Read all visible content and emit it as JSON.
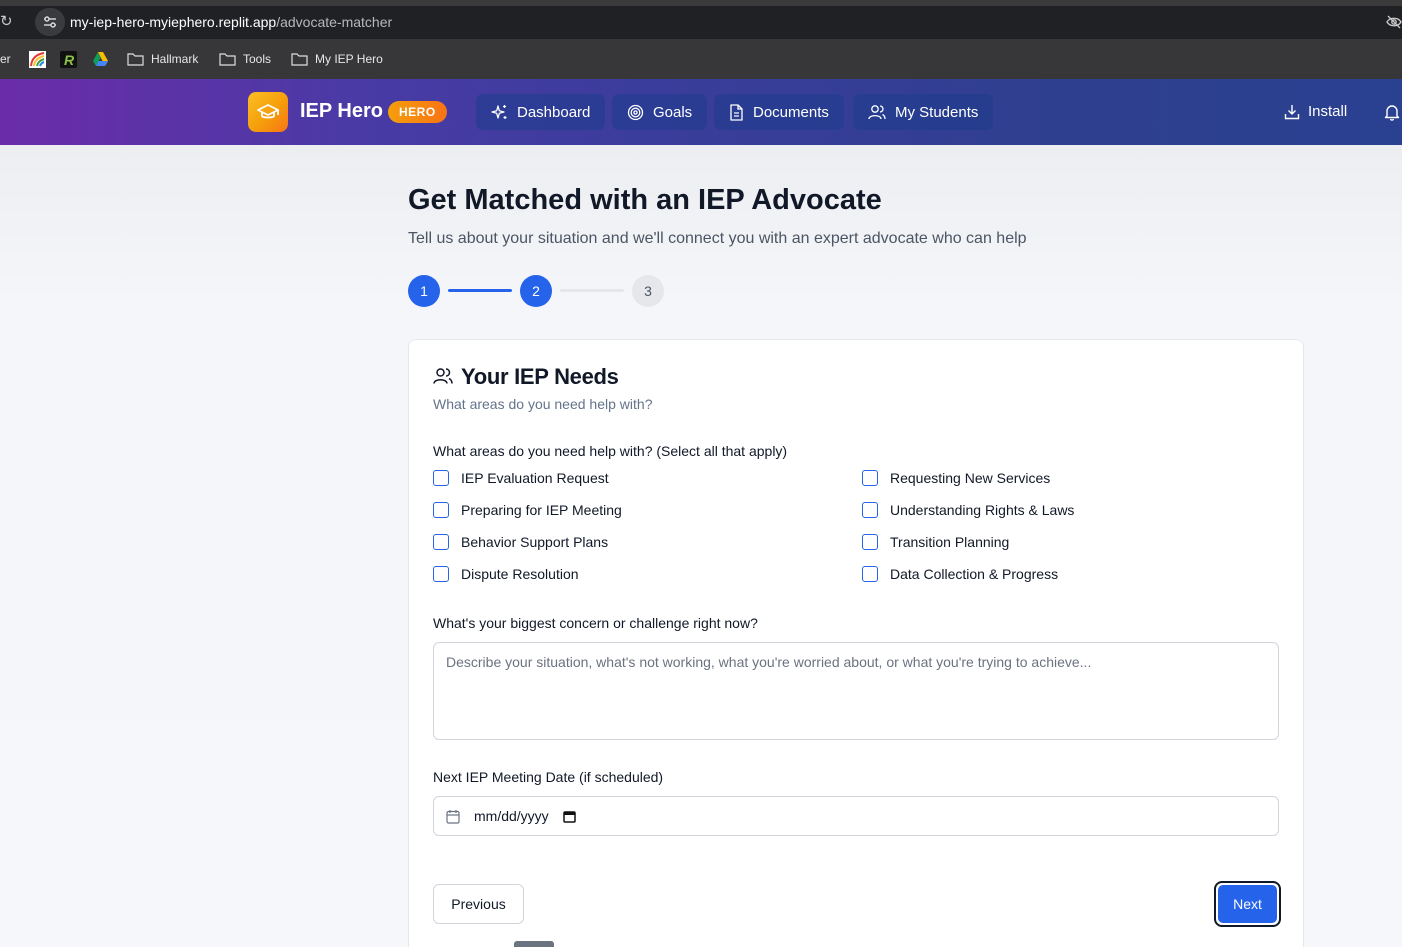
{
  "browser": {
    "url_host": "my-iep-hero-myiephero.replit.app",
    "url_path": "/advocate-matcher",
    "bookmarks": [
      {
        "label": "er",
        "icon": "truncated-item"
      },
      {
        "label": "",
        "icon": "rainbow-favicon"
      },
      {
        "label": "",
        "icon": "r-favicon"
      },
      {
        "label": "",
        "icon": "drive-icon"
      },
      {
        "label": "Hallmark",
        "icon": "folder-icon"
      },
      {
        "label": "Tools",
        "icon": "folder-icon"
      },
      {
        "label": "My IEP Hero",
        "icon": "folder-icon"
      }
    ]
  },
  "header": {
    "brand": "IEP Hero",
    "badge": "HERO",
    "nav": [
      {
        "label": "Dashboard",
        "icon": "sparkles-icon"
      },
      {
        "label": "Goals",
        "icon": "target-icon"
      },
      {
        "label": "Documents",
        "icon": "document-icon"
      },
      {
        "label": "My Students",
        "icon": "users-icon"
      }
    ],
    "install_label": "Install"
  },
  "page": {
    "title": "Get Matched with an IEP Advocate",
    "subtitle": "Tell us about your situation and we'll connect you with an expert advocate who can help"
  },
  "steps": [
    {
      "label": "1",
      "state": "complete"
    },
    {
      "label": "2",
      "state": "current"
    },
    {
      "label": "3",
      "state": "upcoming"
    }
  ],
  "card": {
    "title": "Your IEP Needs",
    "description": "What areas do you need help with?",
    "areas_label": "What areas do you need help with? (Select all that apply)",
    "areas": [
      {
        "label": "IEP Evaluation Request",
        "checked": false
      },
      {
        "label": "Preparing for IEP Meeting",
        "checked": false
      },
      {
        "label": "Behavior Support Plans",
        "checked": false
      },
      {
        "label": "Dispute Resolution",
        "checked": false
      },
      {
        "label": "Requesting New Services",
        "checked": false
      },
      {
        "label": "Understanding Rights & Laws",
        "checked": false
      },
      {
        "label": "Transition Planning",
        "checked": false
      },
      {
        "label": "Data Collection & Progress",
        "checked": false
      }
    ],
    "concern_label": "What's your biggest concern or challenge right now?",
    "concern_placeholder": "Describe your situation, what's not working, what you're worried about, or what you're trying to achieve...",
    "concern_value": "",
    "date_label": "Next IEP Meeting Date (if scheduled)",
    "date_placeholder": "mm/dd/yyyy",
    "previous_label": "Previous",
    "next_label": "Next"
  },
  "colors": {
    "primary": "#2563eb",
    "header_start": "#6b2ca8",
    "header_end": "#2a4090",
    "logo": "#f59e0b"
  }
}
